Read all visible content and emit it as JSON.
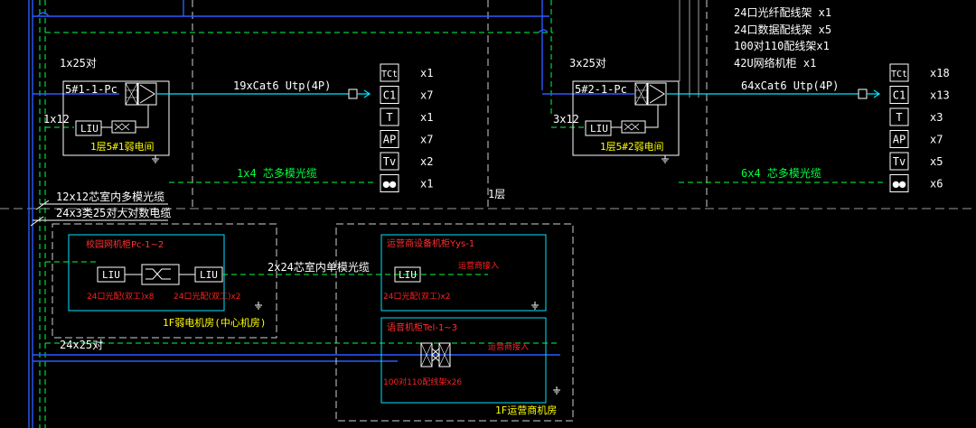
{
  "bldg1": {
    "riser_label": "1x25对",
    "riser_label_fiber": "1x12",
    "cabinet_label": "5#1-1-Pc",
    "room_label": "1层5#1弱电间",
    "liu": "LIU",
    "horiz_cable": "19xCat6  Utp(4P)",
    "fiber_cable": "1x4 芯多模光缆"
  },
  "bldg2": {
    "riser_label": "3x25对",
    "riser_label_fiber": "3x12",
    "cabinet_label": "5#2-1-Pc",
    "room_label": "1层5#2弱电间",
    "liu": "LIU",
    "horiz_cable": "64xCat6  Utp(4P)",
    "fiber_cable": "6x4 芯多模光缆"
  },
  "legend_top": {
    "lines": [
      "24口光纤配线架 x1",
      "24口数据配线架 x5",
      "100对110配线架x1",
      "42U网络机柜   x1"
    ]
  },
  "outlets1": [
    {
      "sym": "TCt",
      "qty": "x1"
    },
    {
      "sym": "C1",
      "qty": "x7"
    },
    {
      "sym": "T",
      "qty": "x1"
    },
    {
      "sym": "AP",
      "qty": "x7"
    },
    {
      "sym": "Tv",
      "qty": "x2"
    },
    {
      "sym": "●●",
      "qty": "x1"
    }
  ],
  "outlets2": [
    {
      "sym": "TCt",
      "qty": "x18"
    },
    {
      "sym": "C1",
      "qty": "x13"
    },
    {
      "sym": "T",
      "qty": "x3"
    },
    {
      "sym": "AP",
      "qty": "x7"
    },
    {
      "sym": "Tv",
      "qty": "x5"
    },
    {
      "sym": "●●",
      "qty": "x6"
    }
  ],
  "floor_label": "1层",
  "trunk": {
    "fiber": "12x12芯室内多模光缆",
    "copper": "24x3类25对大对数电缆",
    "copper_bottom": "24x25对",
    "single_mode": "2x24芯室内单模光缆"
  },
  "center": {
    "cabinet": "校园网机柜Pc-1~2",
    "liu_a": "LIU",
    "liu_b": "LIU",
    "note_a": "24口光配(双工)x8",
    "note_b": "24口光配(双工)x2",
    "room": "1F弱电机房(中心机房)"
  },
  "carrier": {
    "cab1": "运营商设备机柜Yys-1",
    "cab1_liu": "LIU",
    "cab1_note": "运营商接入",
    "cab1_count": "24口光配(双工)x2",
    "cab2": "语音机柜Tel-1~3",
    "cab2_note": "运营商接入",
    "cab2_count": "100对110配线架x26",
    "room": "1F运营商机房"
  }
}
